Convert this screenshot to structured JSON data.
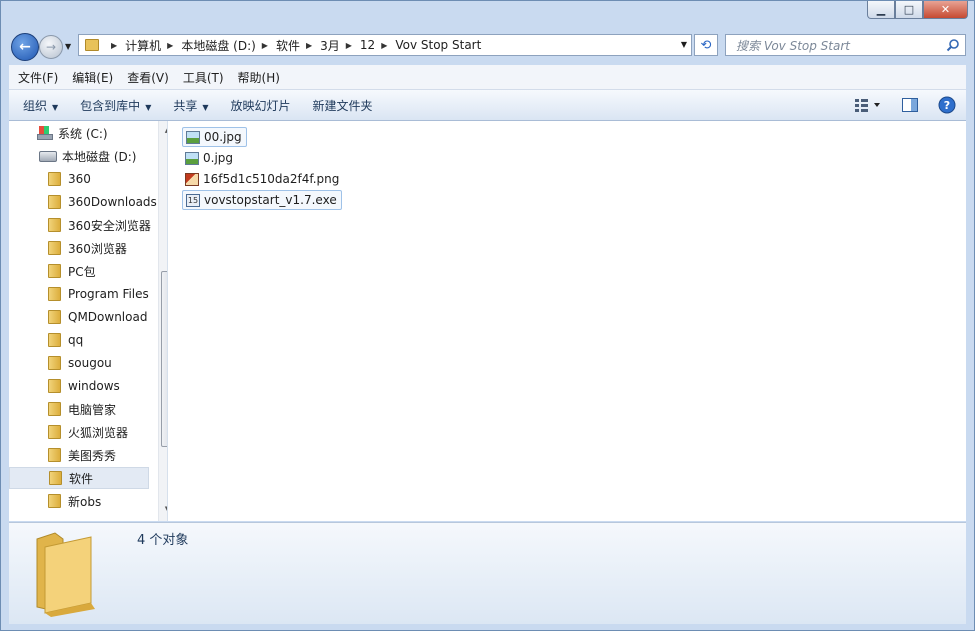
{
  "window": {
    "min": "▁",
    "max": "□",
    "close": "✕"
  },
  "nav": {
    "back_icon": "←",
    "forward_icon": "→",
    "dropdown_icon": "▼",
    "breadcrumbs": [
      "计算机",
      "本地磁盘 (D:)",
      "软件",
      "3月",
      "12",
      "Vov Stop Start"
    ],
    "address_drop_icon": "▼",
    "refresh_icon": "⟲",
    "search_placeholder": "搜索 Vov Stop Start"
  },
  "menu": [
    "文件(F)",
    "编辑(E)",
    "查看(V)",
    "工具(T)",
    "帮助(H)"
  ],
  "toolbar": {
    "organize": "组织",
    "include_library": "包含到库中",
    "share": "共享",
    "slideshow": "放映幻灯片",
    "new_folder": "新建文件夹",
    "arrow": "▼"
  },
  "tree": [
    {
      "label": "系统 (C:)",
      "kind": "sysdrive"
    },
    {
      "label": "本地磁盘 (D:)",
      "kind": "drive"
    },
    {
      "label": "360",
      "kind": "folder"
    },
    {
      "label": "360Downloads",
      "kind": "folder"
    },
    {
      "label": "360安全浏览器",
      "kind": "folder"
    },
    {
      "label": "360浏览器",
      "kind": "folder"
    },
    {
      "label": "PC包",
      "kind": "folder"
    },
    {
      "label": "Program Files",
      "kind": "folder"
    },
    {
      "label": "QMDownload",
      "kind": "folder"
    },
    {
      "label": "qq",
      "kind": "folder"
    },
    {
      "label": "sougou",
      "kind": "folder"
    },
    {
      "label": "windows",
      "kind": "folder"
    },
    {
      "label": "电脑管家",
      "kind": "folder"
    },
    {
      "label": "火狐浏览器",
      "kind": "folder"
    },
    {
      "label": "美图秀秀",
      "kind": "folder"
    },
    {
      "label": "软件",
      "kind": "folder",
      "selected": true
    },
    {
      "label": "新obs",
      "kind": "folder"
    }
  ],
  "scroll": {
    "up": "▲",
    "down": "▼"
  },
  "files": [
    {
      "name": "00.jpg",
      "type": "img",
      "highlight": true
    },
    {
      "name": "0.jpg",
      "type": "img",
      "highlight": false
    },
    {
      "name": "16f5d1c510da2f4f.png",
      "type": "png",
      "highlight": false
    },
    {
      "name": "vovstopstart_v1.7.exe",
      "type": "exe",
      "highlight": true,
      "icon_text": "15"
    }
  ],
  "status": {
    "count": "4 个对象"
  }
}
